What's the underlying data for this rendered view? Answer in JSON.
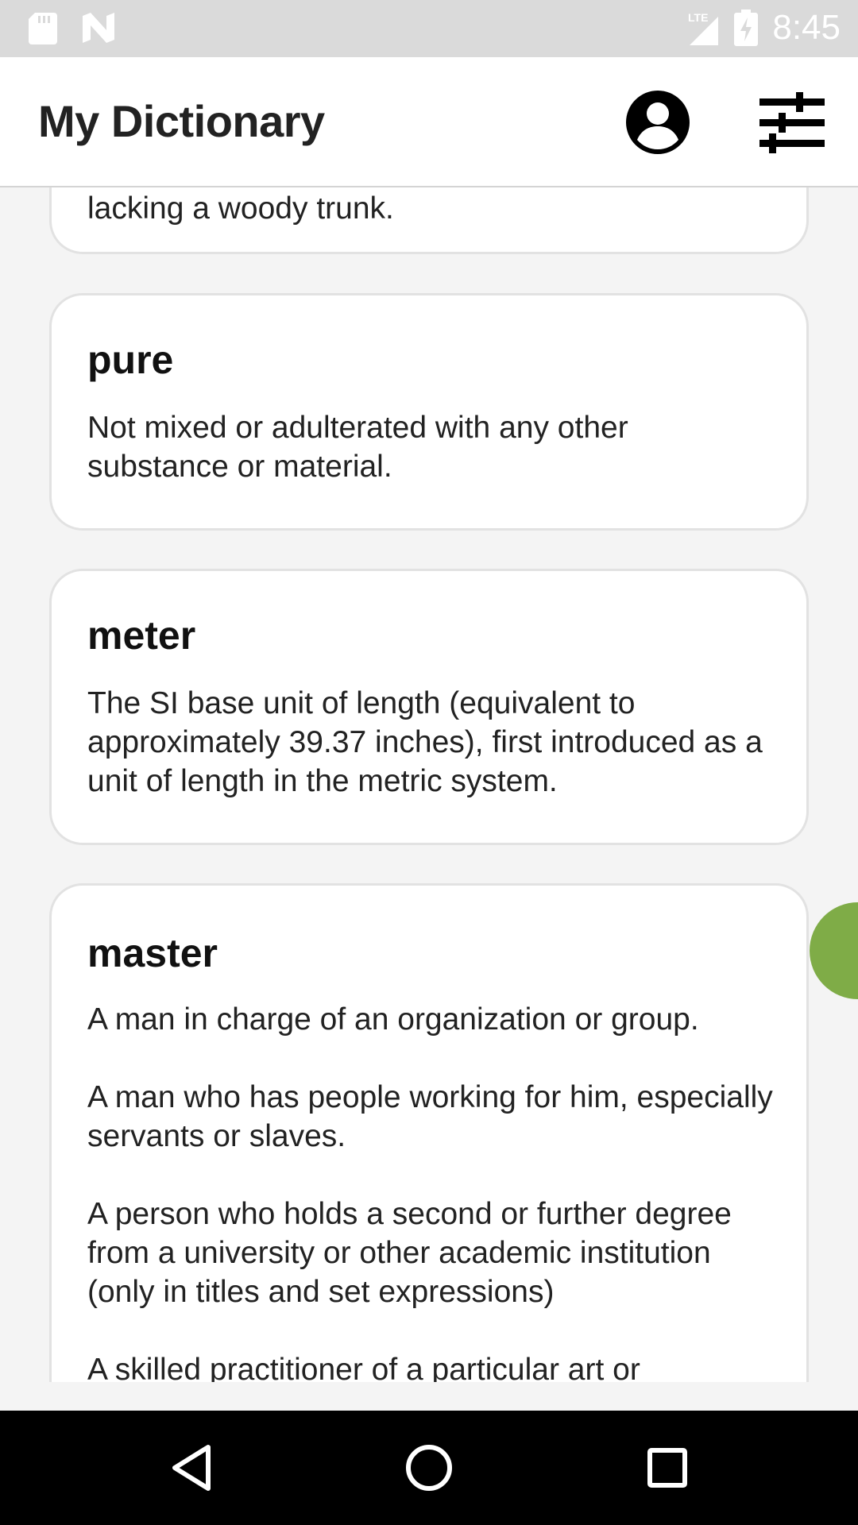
{
  "status_bar": {
    "time": "8:45",
    "icons": [
      "sd-card-icon",
      "n-notification-icon",
      "lte-signal-icon",
      "battery-charging-icon"
    ]
  },
  "app_bar": {
    "title": "My Dictionary",
    "icons": [
      "account-circle-icon",
      "tune-sliders-icon"
    ]
  },
  "entries": [
    {
      "word": "",
      "definitions": [
        "lacking a woody trunk."
      ]
    },
    {
      "word": "pure",
      "definitions": [
        "Not mixed or adulterated with any other substance or material."
      ]
    },
    {
      "word": "meter",
      "definitions": [
        "The SI base unit of length (equivalent to approximately 39.37 inches), first introduced as a unit of length in the metric system."
      ]
    },
    {
      "word": "master",
      "definitions": [
        "A man in charge of an organization or group.",
        "A man who has people working for him, especially servants or slaves.",
        "A person who holds a second or further degree from a university or other academic institution (only in titles and set expressions)",
        "A skilled practitioner of a particular art or"
      ]
    }
  ],
  "colors": {
    "status_bar": "#dadada",
    "app_bar": "#ffffff",
    "background": "#f4f4f4",
    "fab": "#7fac47",
    "nav_bar": "#000000"
  },
  "nav_bar": {
    "icons": [
      "back-triangle-icon",
      "home-circle-icon",
      "recents-square-icon"
    ]
  }
}
